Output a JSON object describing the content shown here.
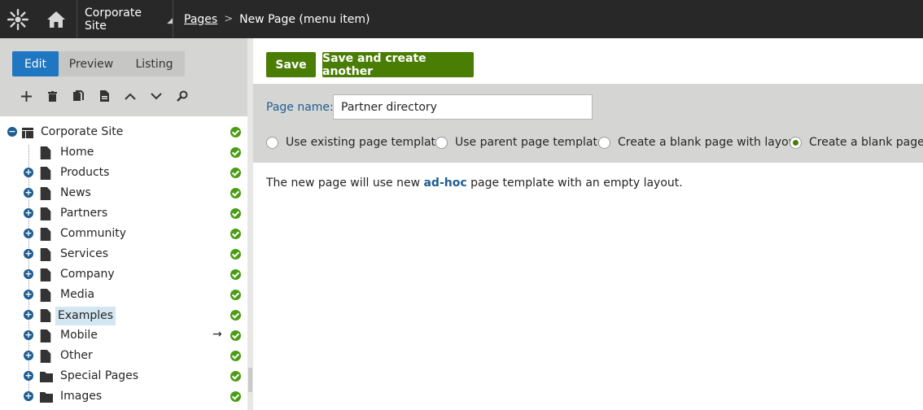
{
  "header": {
    "logo_icon": "kentico-logo-icon",
    "home_icon": "home-icon",
    "site_selector": "Corporate Site",
    "breadcrumb": {
      "pages_link": "Pages",
      "separator": ">",
      "current": "New Page (menu item)"
    }
  },
  "left_panel": {
    "tabs": [
      {
        "label": "Edit",
        "active": true
      },
      {
        "label": "Preview",
        "active": false
      },
      {
        "label": "Listing",
        "active": false
      }
    ],
    "toolbar_icons": [
      "add-icon",
      "delete-icon",
      "copy-icon",
      "document-icon",
      "move-up-icon",
      "move-down-icon",
      "search-icon"
    ],
    "tree": {
      "root": {
        "label": "Corporate Site",
        "status": "published"
      },
      "nodes": [
        {
          "label": "Home",
          "expandable": false,
          "icon": "page-icon"
        },
        {
          "label": "Products",
          "expandable": true,
          "icon": "page-icon"
        },
        {
          "label": "News",
          "expandable": true,
          "icon": "page-icon"
        },
        {
          "label": "Partners",
          "expandable": true,
          "icon": "page-icon"
        },
        {
          "label": "Community",
          "expandable": true,
          "icon": "page-icon"
        },
        {
          "label": "Services",
          "expandable": true,
          "icon": "page-icon"
        },
        {
          "label": "Company",
          "expandable": true,
          "icon": "page-icon"
        },
        {
          "label": "Media",
          "expandable": true,
          "icon": "page-icon"
        },
        {
          "label": "Examples",
          "expandable": true,
          "icon": "page-icon",
          "selected": true
        },
        {
          "label": "Mobile",
          "expandable": true,
          "icon": "page-icon",
          "redirect_arrow": "→"
        },
        {
          "label": "Other",
          "expandable": true,
          "icon": "page-icon"
        },
        {
          "label": "Special Pages",
          "expandable": true,
          "icon": "folder-icon"
        },
        {
          "label": "Images",
          "expandable": true,
          "icon": "folder-icon"
        }
      ]
    }
  },
  "right_panel": {
    "buttons": {
      "save": "Save",
      "save_and_create": "Save and create another"
    },
    "page_name": {
      "label": "Page name:",
      "value": "Partner directory"
    },
    "template_options": [
      {
        "label": "Use existing page template",
        "selected": false
      },
      {
        "label": "Use parent page template",
        "selected": false
      },
      {
        "label": "Create a blank page with layout",
        "selected": false
      },
      {
        "label": "Create a blank page",
        "selected": true
      }
    ],
    "info": {
      "prefix": "The new page will use new ",
      "highlight": "ad-hoc",
      "suffix": " page template with an empty layout."
    }
  },
  "colors": {
    "accent": "#1e77c0",
    "save_green": "#497d04",
    "status_green": "#4a9c13",
    "header_bg": "#292828",
    "panel_gray": "#d5d6d4"
  }
}
